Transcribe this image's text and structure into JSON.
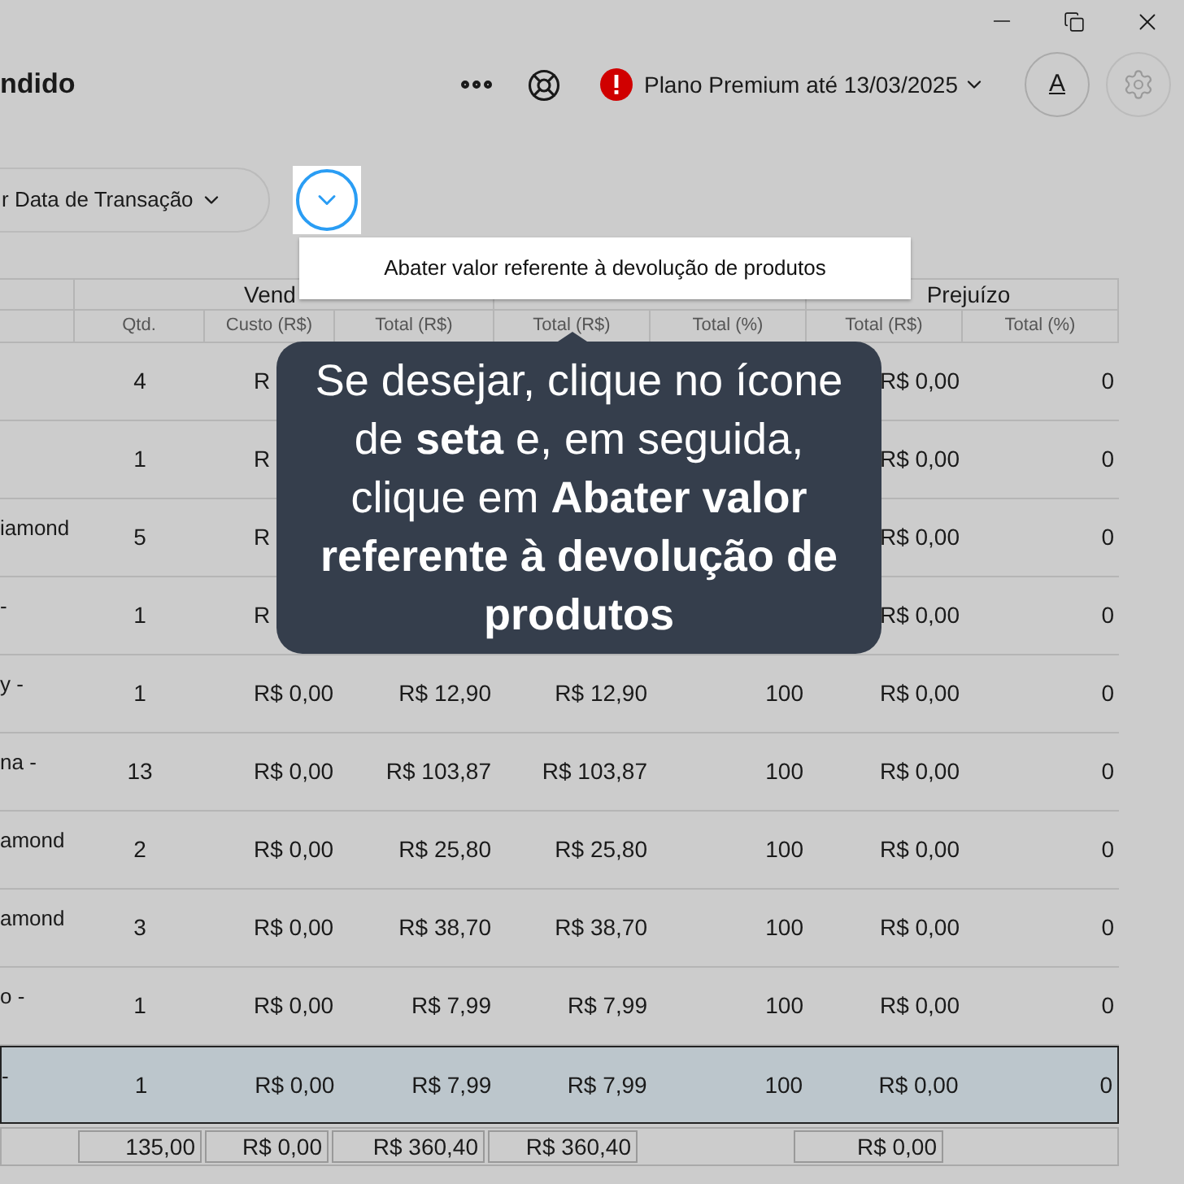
{
  "header": {
    "title": "ndido",
    "plan": "Plano Premium até 13/03/2025",
    "account_letter": "A"
  },
  "toolbar": {
    "filter": "r Data de Transação",
    "expanded": true
  },
  "menu": {
    "items": [
      "Abater valor referente à devolução de produtos"
    ]
  },
  "table": {
    "groups": [
      "Vend",
      "Prejuízo"
    ],
    "columns": [
      "Qtd.",
      "Custo (R$)",
      "Total (R$)",
      "Total (R$)",
      "Total (%)",
      "Total (R$)",
      "Total (%)"
    ],
    "rows": [
      {
        "selected": false,
        "cells": [
          "4",
          "R",
          null,
          null,
          null,
          "R$ 0,00",
          "0"
        ]
      },
      {
        "selected": false,
        "cells": [
          "1",
          "R",
          null,
          null,
          null,
          "R$ 0,00",
          "0"
        ]
      },
      {
        "selected": false,
        "product": "iamond",
        "cells": [
          "5",
          "R",
          null,
          null,
          null,
          "R$ 0,00",
          "0"
        ]
      },
      {
        "selected": false,
        "product": "-",
        "cells": [
          "1",
          "R",
          null,
          null,
          null,
          "R$ 0,00",
          "0"
        ]
      },
      {
        "selected": false,
        "product": "y -",
        "cells": [
          "1",
          "R$ 0,00",
          "R$ 12,90",
          "R$ 12,90",
          "100",
          "R$ 0,00",
          "0"
        ]
      },
      {
        "selected": false,
        "product": "na -",
        "cells": [
          "13",
          "R$ 0,00",
          "R$ 103,87",
          "R$ 103,87",
          "100",
          "R$ 0,00",
          "0"
        ]
      },
      {
        "selected": false,
        "product": "amond",
        "cells": [
          "2",
          "R$ 0,00",
          "R$ 25,80",
          "R$ 25,80",
          "100",
          "R$ 0,00",
          "0"
        ]
      },
      {
        "selected": false,
        "product": "amond",
        "cells": [
          "3",
          "R$ 0,00",
          "R$ 38,70",
          "R$ 38,70",
          "100",
          "R$ 0,00",
          "0"
        ]
      },
      {
        "selected": false,
        "product": "o -",
        "cells": [
          "1",
          "R$ 0,00",
          "R$ 7,99",
          "R$ 7,99",
          "100",
          "R$ 0,00",
          "0"
        ]
      },
      {
        "selected": true,
        "product": "-",
        "cells": [
          "1",
          "R$ 0,00",
          "R$ 7,99",
          "R$ 7,99",
          "100",
          "R$ 0,00",
          "0"
        ]
      }
    ],
    "totals": [
      {
        "kind": "value",
        "text": "135,00"
      },
      {
        "kind": "value",
        "text": "R$ 0,00"
      },
      {
        "kind": "value",
        "text": "R$ 360,40"
      },
      {
        "kind": "value",
        "text": "R$ 360,40"
      },
      {
        "kind": "blank"
      },
      {
        "kind": "value",
        "text": "R$ 0,00"
      }
    ]
  },
  "tooltip": {
    "text": "Se desejar, clique no ícone de **seta** e, em seguida, clique em **Abater valor referente à devolução de produtos**"
  }
}
